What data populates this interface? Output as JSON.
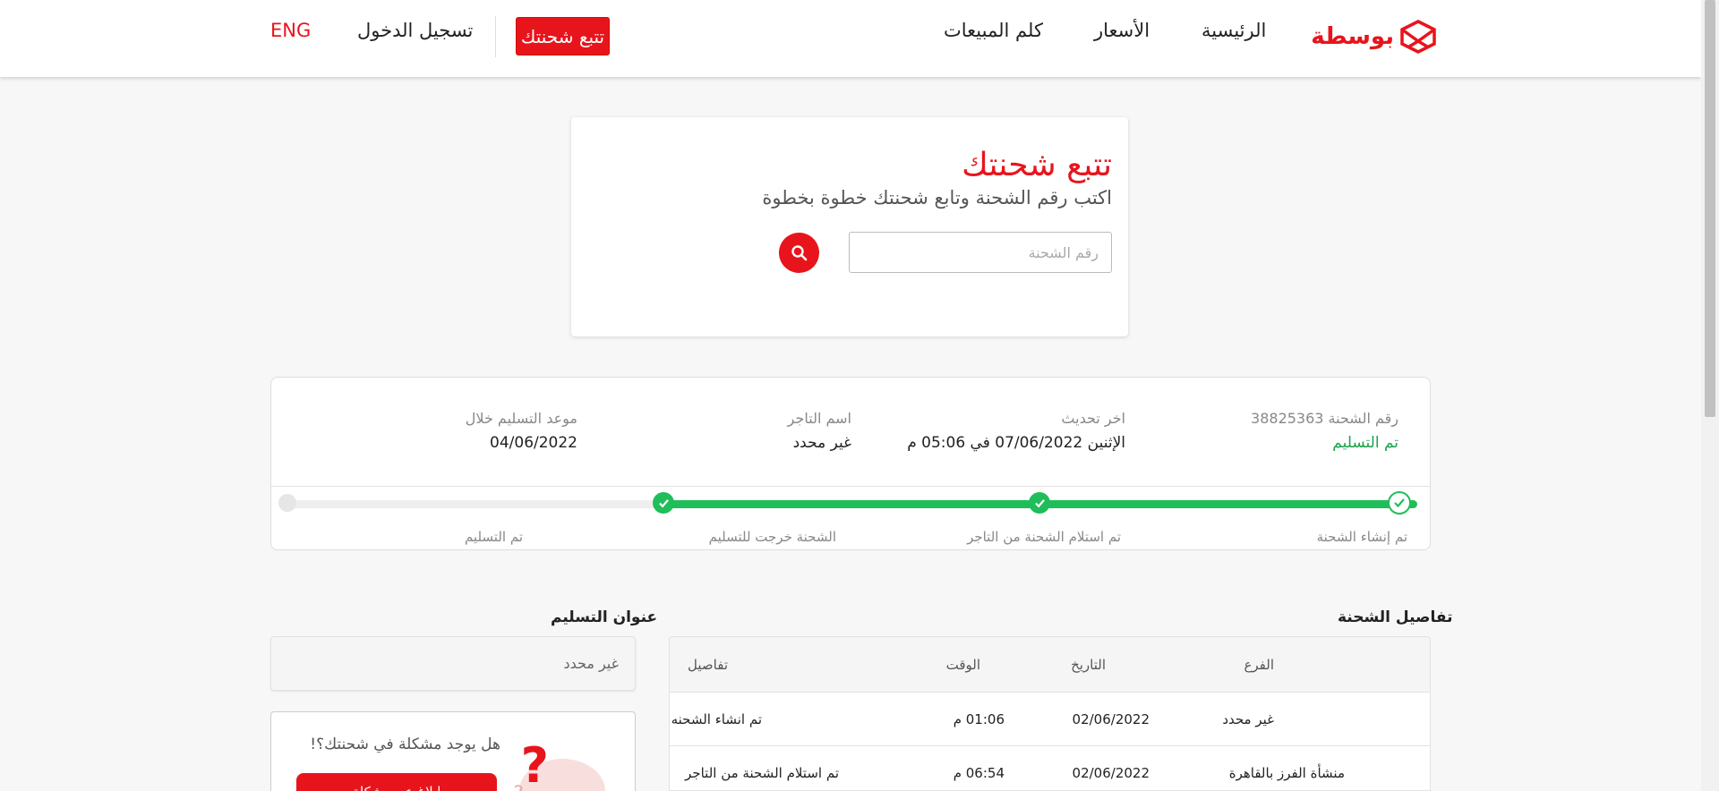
{
  "header": {
    "logo_text": "بوسطة",
    "nav": {
      "home": "الرئيسية",
      "prices": "الأسعار",
      "sales": "كلم المبيعات"
    },
    "track_button": "تتبع شحنتك",
    "login": "تسجيل الدخول",
    "lang": "ENG"
  },
  "search": {
    "title": "تتبع شحنتك",
    "subtitle": "اكتب رقم الشحنة وتابع شحنتك خطوة بخطوة",
    "placeholder": "رقم الشحنة"
  },
  "status": {
    "shipment_label": "رقم الشحنة 38825363",
    "shipment_status": "تم التسليم",
    "last_update_label": "اخر تحديث",
    "last_update_value": "الإثنين 07/06/2022 في 05:06 م",
    "merchant_label": "اسم التاجر",
    "merchant_value": "غير محدد",
    "delivery_label": "موعد التسليم خلال",
    "delivery_value": "04/06/2022",
    "steps": [
      "تم إنشاء الشحنة",
      "تم استلام الشحنة من التاجر",
      "الشحنة خرجت للتسليم",
      "تم التسليم"
    ],
    "colors": {
      "complete": "#1fbe5a",
      "pending": "#eeeeee",
      "brand": "#e8141c"
    }
  },
  "details": {
    "title": "تفاصيل الشحنة",
    "columns": {
      "branch": "الفرع",
      "date": "التاريخ",
      "time": "الوقت",
      "details": "تفاصيل"
    },
    "rows": [
      {
        "branch": "غير محدد",
        "date": "02/06/2022",
        "time": "01:06 م",
        "details": "تم انشاء الشحنه"
      },
      {
        "branch": "منشأة الفرز بالقاهرة",
        "date": "02/06/2022",
        "time": "06:54 م",
        "details": "تم استلام الشحنة من التاجر"
      }
    ]
  },
  "address": {
    "title": "عنوان التسليم",
    "value": "غير محدد"
  },
  "problem": {
    "question": "هل يوجد مشكلة في شحنتك؟!",
    "button": "ابلاغ عن مشكلة"
  }
}
